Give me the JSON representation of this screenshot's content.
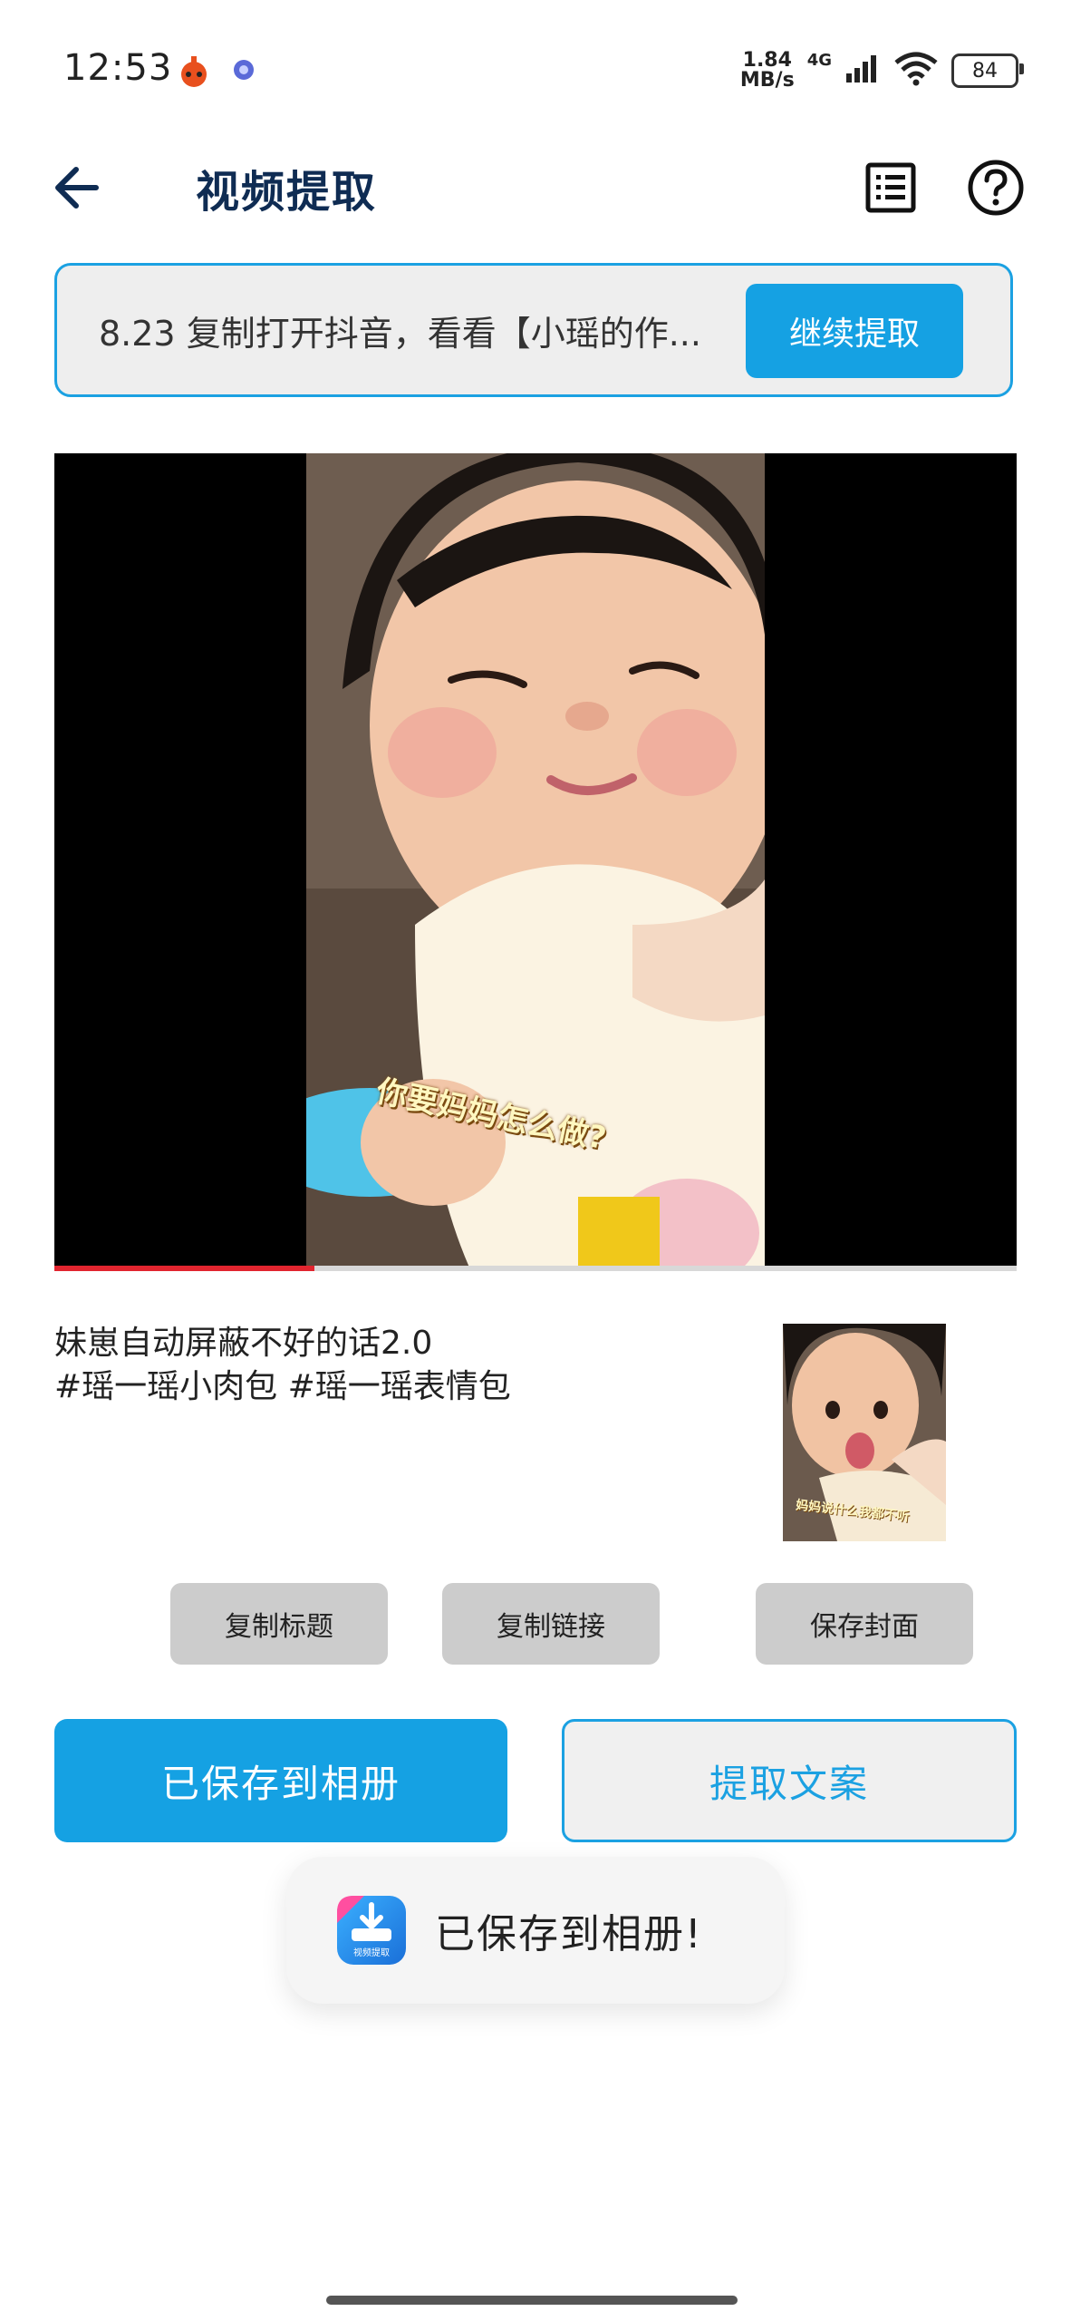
{
  "status_bar": {
    "time": "12:53",
    "net_speed_value": "1.84",
    "net_speed_unit": "MB/s",
    "network": "4G",
    "battery": "84",
    "icons": [
      "app-notification-icon",
      "small-dot-icon",
      "signal-icon",
      "wifi-icon",
      "battery-icon"
    ]
  },
  "header": {
    "title": "视频提取",
    "icons": [
      "back-arrow-icon",
      "list-icon",
      "help-icon"
    ]
  },
  "url_box": {
    "text": "8.23 复制打开抖音，看看【小瑶的作...",
    "continue_label": "继续提取"
  },
  "video": {
    "caption": "你要妈妈怎么做?",
    "progress": 0.27
  },
  "description": {
    "text": "妹崽自动屏蔽不好的话2.0\n#瑶一瑶小肉包 #瑶一瑶表情包",
    "cover_caption": "妈妈说什么我都不听"
  },
  "actions": {
    "copy_title": "复制标题",
    "copy_link": "复制链接",
    "save_cover": "保存封面",
    "saved_to_album": "已保存到相册",
    "extract_text": "提取文案"
  },
  "toast": {
    "message": "已保存到相册!",
    "icon_label": "视频提取"
  },
  "colors": {
    "accent": "#15a1e3",
    "title": "#0f2c53",
    "progress": "#e1252f",
    "gray_button": "#cccccc"
  }
}
